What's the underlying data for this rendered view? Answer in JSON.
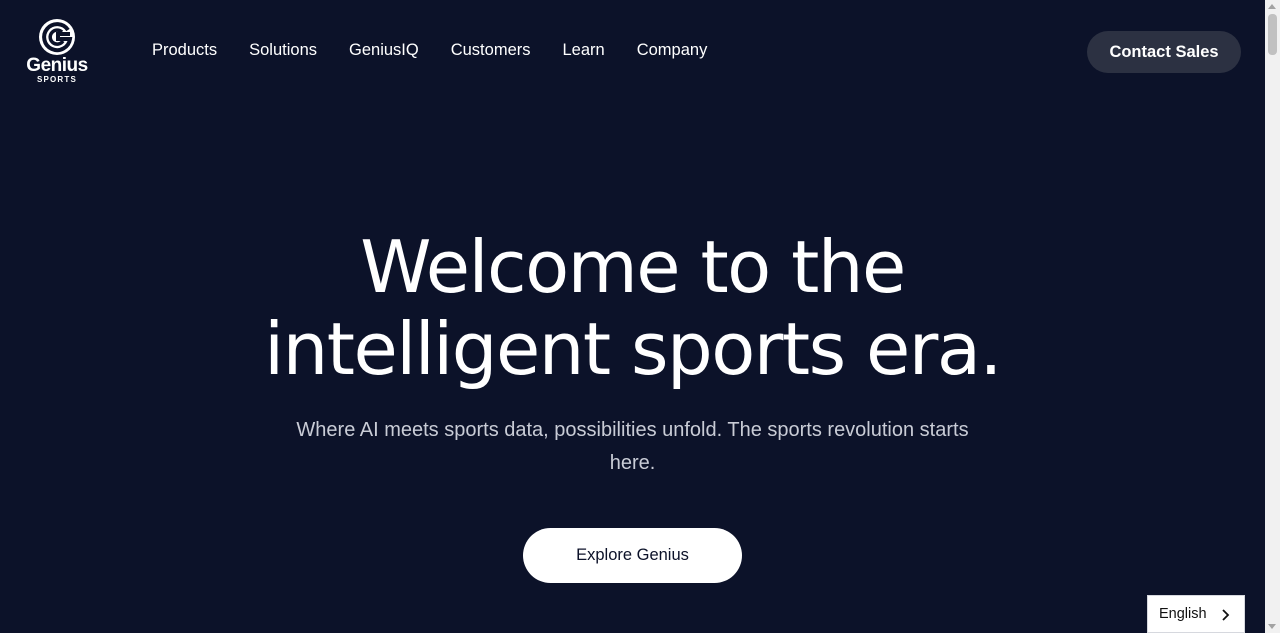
{
  "header": {
    "logo": {
      "icon": "genius-g-logo-icon",
      "word": "Genius",
      "sub": "SPORTS"
    },
    "nav": [
      {
        "label": "Products"
      },
      {
        "label": "Solutions"
      },
      {
        "label": "GeniusIQ"
      },
      {
        "label": "Customers"
      },
      {
        "label": "Learn"
      },
      {
        "label": "Company"
      }
    ],
    "contact_label": "Contact Sales"
  },
  "hero": {
    "title_line1": "Welcome to the",
    "title_line2": "intelligent sports era.",
    "subtitle": "Where AI meets sports data, possibilities unfold. The sports revolution starts here.",
    "cta_label": "Explore Genius"
  },
  "language": {
    "selected": "English",
    "icon": "chevron-right-icon"
  },
  "colors": {
    "background": "#0c1229",
    "contact_button": "#2c3142",
    "cta_button": "#ffffff",
    "subtitle_text": "#c9ccd6"
  }
}
